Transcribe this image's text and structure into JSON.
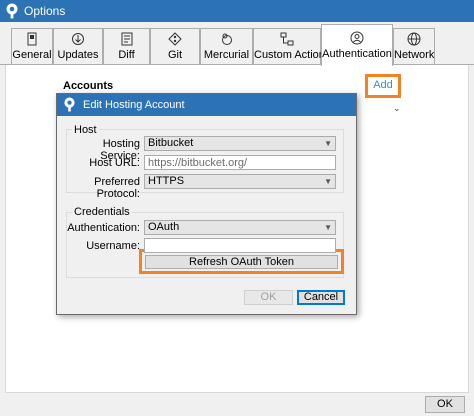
{
  "window": {
    "title": "Options"
  },
  "tabs": [
    {
      "label": "General",
      "icon": "switch-icon"
    },
    {
      "label": "Updates",
      "icon": "update-icon"
    },
    {
      "label": "Diff",
      "icon": "diff-icon"
    },
    {
      "label": "Git",
      "icon": "git-icon"
    },
    {
      "label": "Mercurial",
      "icon": "mercurial-icon"
    },
    {
      "label": "Custom Actions",
      "icon": "custom-actions-icon"
    },
    {
      "label": "Authentication",
      "icon": "user-icon",
      "active": true
    },
    {
      "label": "Network",
      "icon": "globe-icon"
    }
  ],
  "accounts": {
    "heading": "Accounts",
    "add_label": "Add"
  },
  "dialog": {
    "title": "Edit Hosting Account",
    "host_group": "Host",
    "hosting_service_label": "Hosting Service:",
    "hosting_service_value": "Bitbucket",
    "host_url_label": "Host URL:",
    "host_url_placeholder": "https://bitbucket.org/",
    "protocol_label": "Preferred Protocol:",
    "protocol_value": "HTTPS",
    "credentials_group": "Credentials",
    "authentication_label": "Authentication:",
    "authentication_value": "OAuth",
    "username_label": "Username:",
    "username_value": "",
    "refresh_label": "Refresh OAuth Token",
    "ok_label": "OK",
    "cancel_label": "Cancel"
  },
  "footer": {
    "ok_label": "OK"
  },
  "colors": {
    "titlebar": "#2b73b5",
    "highlight": "#f28322",
    "link": "#3b8ad8"
  }
}
